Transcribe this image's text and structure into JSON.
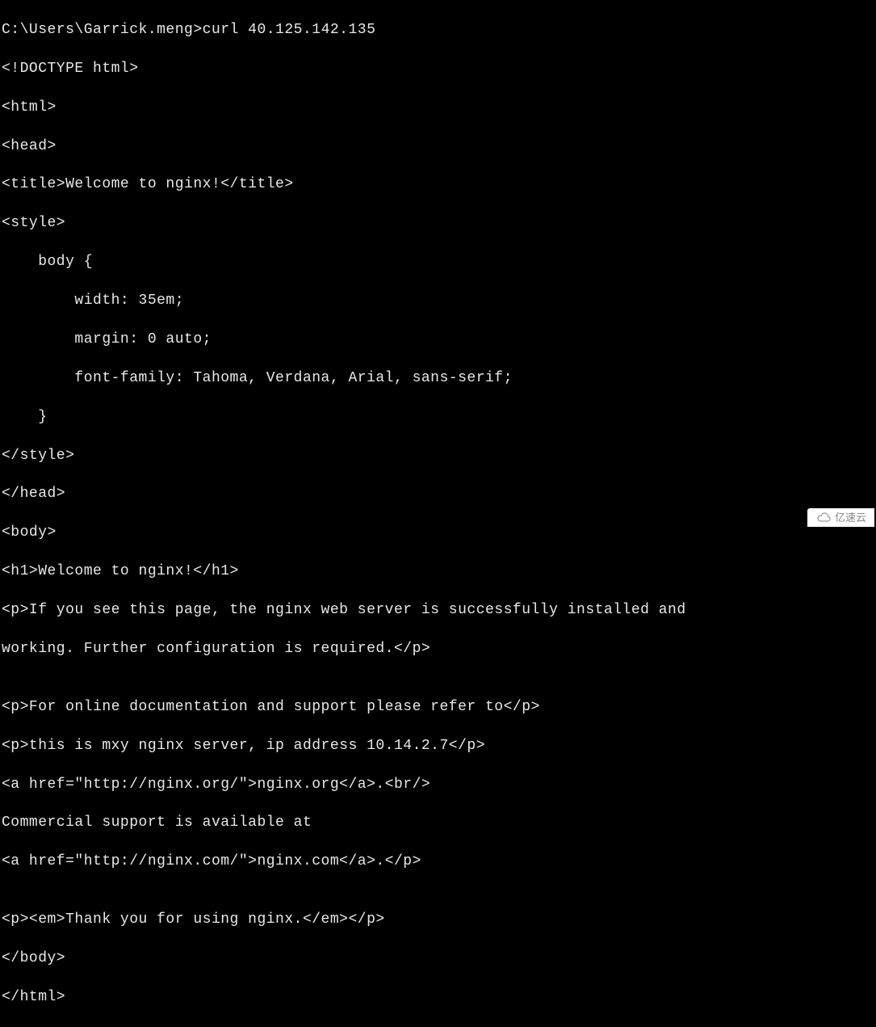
{
  "terminal": {
    "prompt": "C:\\Users\\Garrick.meng>",
    "command": "curl 40.125.142.135",
    "output": {
      "line1": "<!DOCTYPE html>",
      "line2": "<html>",
      "line3": "<head>",
      "line4": "<title>Welcome to nginx!</title>",
      "line5": "<style>",
      "line6": "    body {",
      "line7": "        width: 35em;",
      "line8": "        margin: 0 auto;",
      "line9": "        font-family: Tahoma, Verdana, Arial, sans-serif;",
      "line10": "    }",
      "line11": "</style>",
      "line12": "</head>",
      "line13": "<body>",
      "line14": "<h1>Welcome to nginx!</h1>",
      "line15": "<p>If you see this page, the nginx web server is successfully installed and",
      "line16": "working. Further configuration is required.</p>",
      "line17": "",
      "line18": "<p>For online documentation and support please refer to</p>",
      "line19": "<p>this is mxy nginx server, ip address 10.14.2.7</p>",
      "line20": "<a href=\"http://nginx.org/\">nginx.org</a>.<br/>",
      "line21": "Commercial support is available at",
      "line22": "<a href=\"http://nginx.com/\">nginx.com</a>.</p>",
      "line23": "",
      "line24": "<p><em>Thank you for using nginx.</em></p>",
      "line25": "</body>",
      "line26": "</html>"
    }
  },
  "watermark": {
    "text": "亿速云"
  }
}
